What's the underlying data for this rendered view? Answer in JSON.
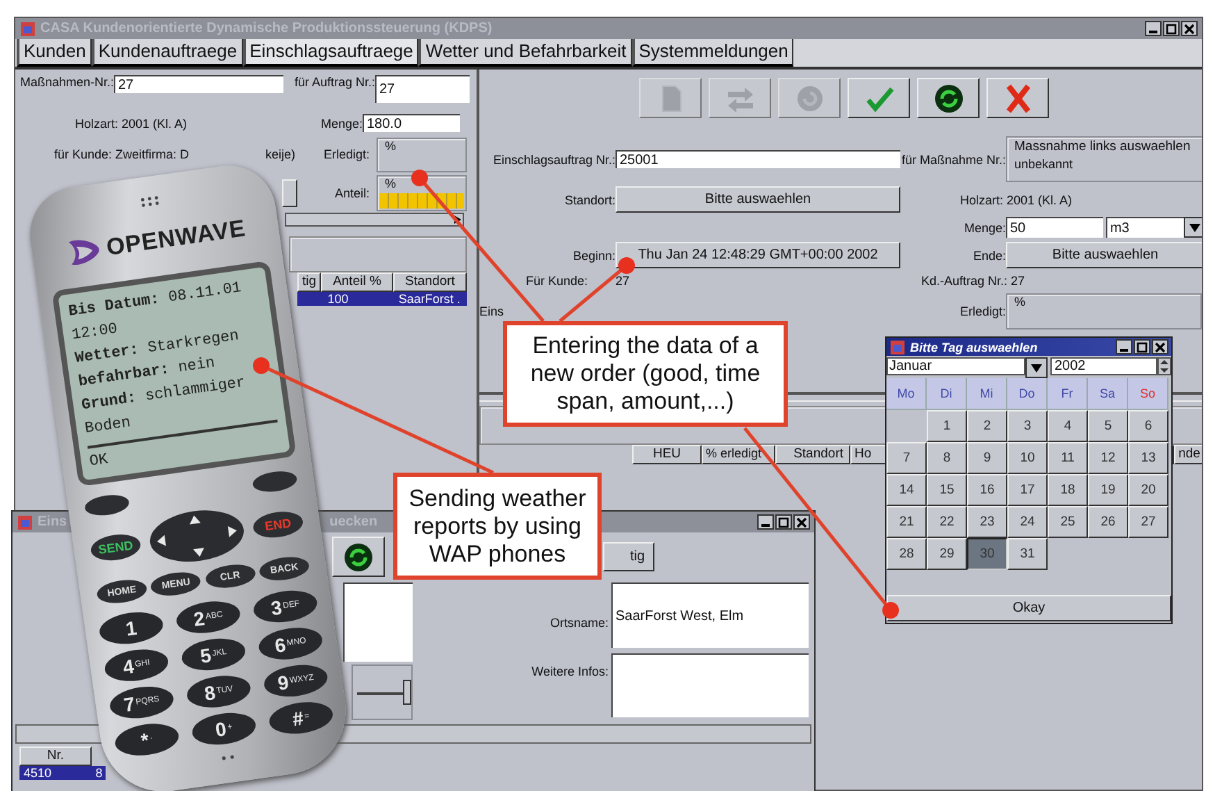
{
  "window": {
    "title": "CASA  Kundenorientierte Dynamische Produktionssteuerung (KDPS)"
  },
  "tabs": [
    {
      "label": "Kunden",
      "selected": false
    },
    {
      "label": "Kundenauftraege",
      "selected": false
    },
    {
      "label": "Einschlagsauftraege",
      "selected": true
    },
    {
      "label": "Wetter und Befahrbarkeit",
      "selected": false
    },
    {
      "label": "Systemmeldungen",
      "selected": false
    }
  ],
  "measure_panel": {
    "measure_label": "Maßnahmen-Nr.:",
    "measure_value": "27",
    "order_label": "für Auftrag Nr.:",
    "order_value": "27",
    "wood_type": "Holzart: 2001 (Kl. A)",
    "amount_label": "Menge:",
    "amount_value": "180.0",
    "customer_text": "für Kunde: Zweitfirma: D",
    "customer_tail": "keije)",
    "done_label": "Erledigt:",
    "done": {
      "unit": "%",
      "level": 0
    },
    "share_label": "Anteil:",
    "share": {
      "unit": "%",
      "level": 1
    },
    "table": {
      "columns": [
        "tig",
        "Anteil %",
        "Standort"
      ],
      "rows": [
        {
          "cells": [
            "",
            "100",
            "SaarForst ."
          ],
          "selected": true
        }
      ]
    }
  },
  "felling_order": {
    "toolbar": [
      {
        "kind": "document",
        "disabled": true
      },
      {
        "kind": "transfer",
        "disabled": true
      },
      {
        "kind": "refresh",
        "disabled": true
      },
      {
        "kind": "check",
        "disabled": false
      },
      {
        "kind": "recycle",
        "disabled": false
      },
      {
        "kind": "cancel",
        "disabled": false
      }
    ],
    "order_number_label": "Einschlagsauftrag Nr.:",
    "order_number": "25001",
    "measure_label": "für Maßnahme Nr.:",
    "measure_group_title": "Massnahme links auswaehlen",
    "measure_value": "unbekannt",
    "location_label": "Standort:",
    "location_button": "Bitte auswaehlen",
    "wood_type": "Holzart: 2001 (Kl. A)",
    "amount_label": "Menge:",
    "amount_value": "50",
    "unit": "m3",
    "start_label": "Beginn:",
    "start_button": "Thu Jan 24 12:48:29 GMT+00:00 2002",
    "end_label": "Ende:",
    "end_button": "Bitte auswaehlen",
    "customer_label": "Für Kunde:",
    "customer_value": "27",
    "customer_order": "Kd.-Auftrag Nr.: 27",
    "cut_label": "Eins",
    "done_label": "Erledigt:",
    "done": {
      "unit": "%",
      "level": 0
    },
    "table": {
      "columns": [
        "HEU",
        "% erledigt",
        "Standort",
        "Ho",
        "nde"
      ]
    }
  },
  "site_window": {
    "title_start": "Eins",
    "title_end": "uecken",
    "button": "tig",
    "location_label": "Ortsname:",
    "location_value": "SaarForst West, Elm",
    "info_label": "Weitere Infos:",
    "slider": {
      "level": 1
    },
    "table": {
      "columns": [
        "Nr."
      ],
      "rows": [
        {
          "cells": [
            "4510",
            "8"
          ],
          "selected": true
        }
      ]
    }
  },
  "calendar": {
    "title": "Bitte Tag auswaehlen",
    "month": "Januar",
    "year": "2002",
    "weekdays": [
      {
        "label": "Mo",
        "color": "#4048a8"
      },
      {
        "label": "Di",
        "color": "#4048a8"
      },
      {
        "label": "Mi",
        "color": "#4048a8"
      },
      {
        "label": "Do",
        "color": "#4048a8"
      },
      {
        "label": "Fr",
        "color": "#4048a8"
      },
      {
        "label": "Sa",
        "color": "#4048a8"
      },
      {
        "label": "So",
        "color": "#e03030"
      }
    ],
    "days": [
      {
        "kind": "blank"
      },
      {
        "kind": "day",
        "label": "1",
        "selected": false
      },
      {
        "kind": "day",
        "label": "2",
        "selected": false
      },
      {
        "kind": "day",
        "label": "3",
        "selected": false
      },
      {
        "kind": "day",
        "label": "4",
        "selected": false
      },
      {
        "kind": "day",
        "label": "5",
        "selected": false
      },
      {
        "kind": "day",
        "label": "6",
        "selected": false
      },
      {
        "kind": "day",
        "label": "7",
        "selected": false
      },
      {
        "kind": "day",
        "label": "8",
        "selected": false
      },
      {
        "kind": "day",
        "label": "9",
        "selected": false
      },
      {
        "kind": "day",
        "label": "10",
        "selected": false
      },
      {
        "kind": "day",
        "label": "11",
        "selected": false
      },
      {
        "kind": "day",
        "label": "12",
        "selected": false
      },
      {
        "kind": "day",
        "label": "13",
        "selected": false
      },
      {
        "kind": "day",
        "label": "14",
        "selected": false
      },
      {
        "kind": "day",
        "label": "15",
        "selected": false
      },
      {
        "kind": "day",
        "label": "16",
        "selected": false
      },
      {
        "kind": "day",
        "label": "17",
        "selected": false
      },
      {
        "kind": "day",
        "label": "18",
        "selected": false
      },
      {
        "kind": "day",
        "label": "19",
        "selected": false
      },
      {
        "kind": "day",
        "label": "20",
        "selected": false
      },
      {
        "kind": "day",
        "label": "21",
        "selected": false
      },
      {
        "kind": "day",
        "label": "22",
        "selected": false
      },
      {
        "kind": "day",
        "label": "23",
        "selected": false
      },
      {
        "kind": "day",
        "label": "24",
        "selected": false
      },
      {
        "kind": "day",
        "label": "25",
        "selected": false
      },
      {
        "kind": "day",
        "label": "26",
        "selected": false
      },
      {
        "kind": "day",
        "label": "27",
        "selected": false
      },
      {
        "kind": "day",
        "label": "28",
        "selected": false
      },
      {
        "kind": "day",
        "label": "29",
        "selected": false
      },
      {
        "kind": "day",
        "label": "30",
        "selected": true
      },
      {
        "kind": "day",
        "label": "31",
        "selected": false
      }
    ],
    "ok_button": "Okay"
  },
  "phone": {
    "logo": "OPENWAVE",
    "screen_lines": [
      "**Bis Datum:** 08.11.01",
      "12:00",
      "**Wetter:** Starkregen",
      "**befahrbar:** nein",
      "**Grund:** schlammiger",
      "Boden"
    ],
    "soft_key": "OK",
    "call_keys": [
      {
        "label": "SEND",
        "kind": "send"
      },
      {
        "label": "END",
        "kind": "end"
      }
    ],
    "function_keys": [
      "HOME",
      "MENU",
      "CLR",
      "BACK"
    ],
    "number_keys": [
      {
        "digit": "1"
      },
      {
        "digit": "2",
        "letters": "ABC"
      },
      {
        "digit": "3",
        "letters": "DEF"
      },
      {
        "digit": "4",
        "letters": "GHI"
      },
      {
        "digit": "5",
        "letters": "JKL"
      },
      {
        "digit": "6",
        "letters": "MNO"
      },
      {
        "digit": "7",
        "letters": "PQRS"
      },
      {
        "digit": "8",
        "letters": "TUV"
      },
      {
        "digit": "9",
        "letters": "WXYZ"
      },
      {
        "digit": "*",
        "letters": "·"
      },
      {
        "digit": "0",
        "letters": "+"
      },
      {
        "digit": "#",
        "letters": "="
      }
    ]
  },
  "callouts": [
    {
      "text": "Entering the data of a new order (good, time span, amount,...)"
    },
    {
      "text": "Sending weather reports by using WAP phones"
    }
  ]
}
